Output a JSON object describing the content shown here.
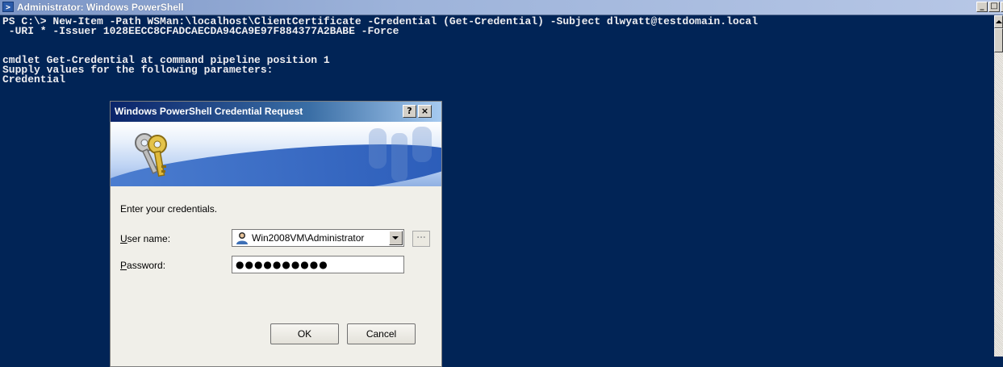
{
  "window": {
    "title": "Administrator: Windows PowerShell",
    "title_icon": "powershell-icon",
    "controls": {
      "minimize": "_",
      "maximize": "□",
      "close": "×"
    }
  },
  "console": {
    "lines": [
      "PS C:\\> New-Item -Path WSMan:\\localhost\\ClientCertificate -Credential (Get-Credential) -Subject dlwyatt@testdomain.local",
      " -URI * -Issuer 1028EECC8CFADCAECDA94CA9E97F884377A2BABE -Force",
      "",
      "cmdlet Get-Credential at command pipeline position 1",
      "Supply values for the following parameters:",
      "Credential"
    ]
  },
  "dialog": {
    "title": "Windows PowerShell Credential Request",
    "help_label": "?",
    "close_label": "×",
    "banner_icon": "keys-icon",
    "prompt": "Enter your credentials.",
    "username": {
      "label_first": "U",
      "label_rest": "ser name:",
      "value": "Win2008VM\\Administrator",
      "icon": "user-icon"
    },
    "password": {
      "label_first": "P",
      "label_rest": "assword:",
      "value": "●●●●●●●●●●"
    },
    "browse_label": "...",
    "ok_label": "OK",
    "cancel_label": "Cancel"
  },
  "colors": {
    "console_bg": "#012456",
    "console_text": "#eeedf0",
    "dialog_bg": "#f0efe9"
  }
}
